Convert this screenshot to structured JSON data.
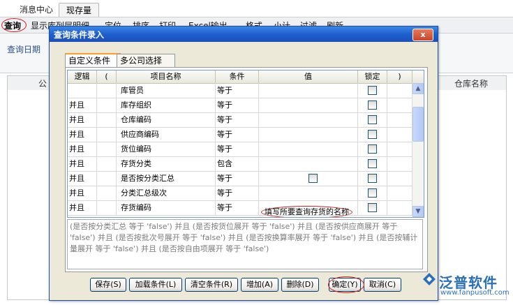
{
  "app": {
    "tabs": [
      "消息中心",
      "现存量"
    ],
    "toolbar": [
      "查询",
      "显示库列层明细",
      "定位",
      "排序",
      "打印",
      "Excel输出",
      "格式",
      "小计",
      "过滤",
      "刷新"
    ],
    "filter_label": "查询日期",
    "grid_headers": [
      "公",
      "仓库名称"
    ]
  },
  "dialog": {
    "title": "查询条件录入",
    "close_label": "x",
    "tabs": [
      "自定义条件",
      "多公司选择"
    ],
    "columns": [
      "逻辑",
      "(",
      "项目名称",
      "条件",
      "值",
      "锁定",
      ")"
    ],
    "rows": [
      {
        "logic": "",
        "item": "库管员",
        "cond": "等于",
        "value": ""
      },
      {
        "logic": "并且",
        "item": "库存组织",
        "cond": "等于",
        "value": ""
      },
      {
        "logic": "并且",
        "item": "仓库编码",
        "cond": "等于",
        "value": ""
      },
      {
        "logic": "并且",
        "item": "供应商编码",
        "cond": "等于",
        "value": ""
      },
      {
        "logic": "并且",
        "item": "货位编码",
        "cond": "等于",
        "value": ""
      },
      {
        "logic": "并且",
        "item": "存货分类",
        "cond": "包含",
        "value": ""
      },
      {
        "logic": "并且",
        "item": "是否按分类汇总",
        "cond": "等于",
        "value": ""
      },
      {
        "logic": "并且",
        "item": "分类汇总级次",
        "cond": "等于",
        "value": ""
      },
      {
        "logic": "并且",
        "item": "存货编码",
        "cond": "等于",
        "value": ""
      }
    ],
    "annotation": "填写所要查询存货的名称",
    "condition_text": "(是否按分类汇总 等于 'false') 并且 (是否按货位展开 等于 'false') 并且 (是否按供应商展开 等于 'false') 并且 (是否按批次号展开 等于 'false') 并且 (是否按换算率展开 等于 'false') 并且 (是否按辅计量展开 等于 'false') 并且 (是否按自由项展开 等于 'false')",
    "buttons": [
      "保存(S)",
      "加载条件(L)",
      "清空条件(R)",
      "增加(A)",
      "删除(D)",
      "确定(Y)",
      "取消(C)"
    ]
  },
  "watermark": {
    "name": "泛普软件",
    "url": "www.fanpusoft.com"
  },
  "colors": {
    "title_bar": "#1f5fcf",
    "highlight": "#d02020",
    "brand": "#2a6fb8"
  }
}
